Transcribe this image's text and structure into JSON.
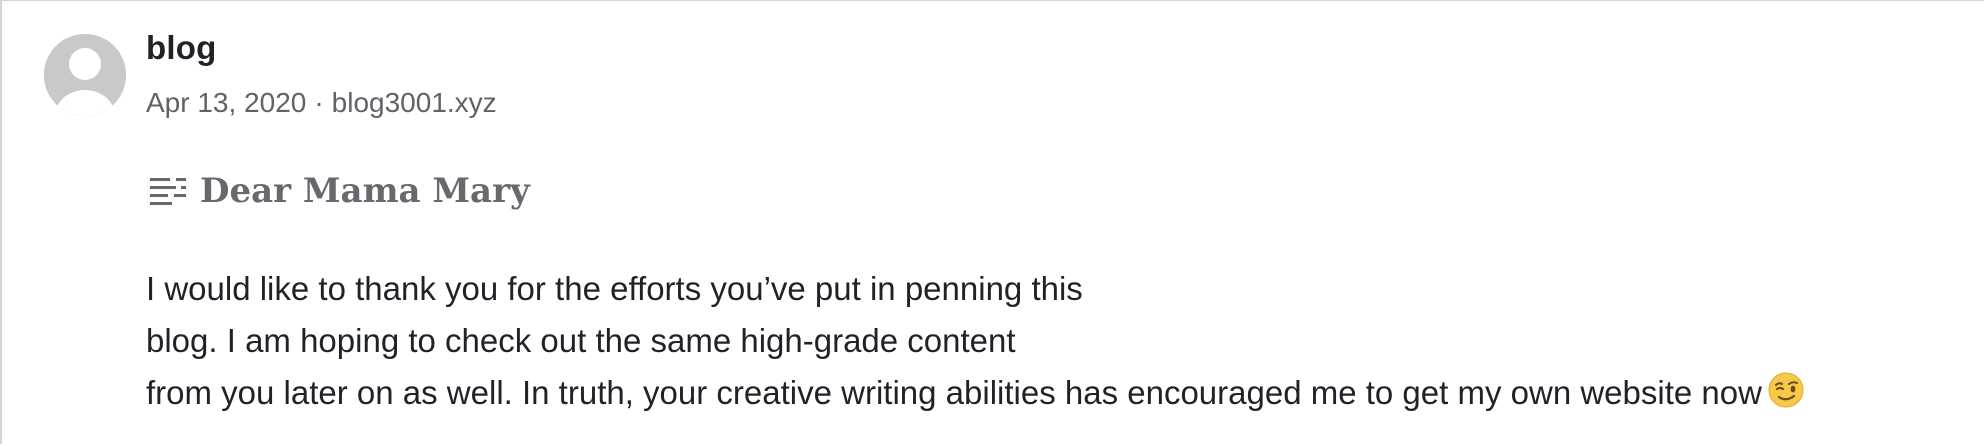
{
  "comment": {
    "author": "blog",
    "date": "Apr 13, 2020",
    "separator": "·",
    "site": "blog3001.xyz",
    "title": "Dear Mama Mary",
    "title_icon": "text-lines-icon",
    "body_lines": [
      "I would like to thank you for the efforts you’ve put in penning this",
      "blog. I am hoping to check out the same high-grade content",
      "from you later on as well. In truth, your creative writing abilities has encouraged me to get my own website now"
    ],
    "emoji": "winking-face-icon"
  },
  "colors": {
    "avatar_bg": "#c9c9c9",
    "text_primary": "#1f2328",
    "text_secondary": "#5f6368",
    "title_color": "#66696e",
    "border": "#d6d6d6"
  }
}
